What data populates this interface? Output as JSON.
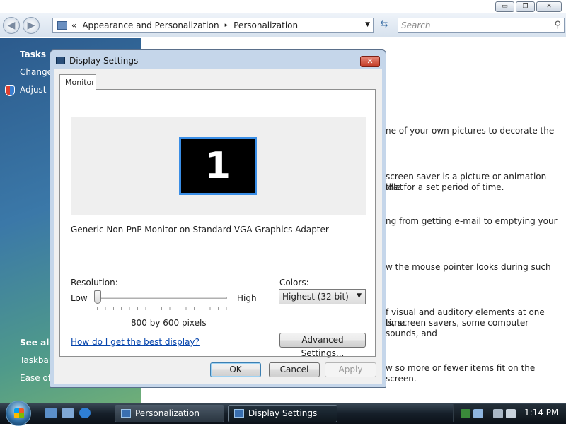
{
  "explorer": {
    "window_controls": {
      "minimize": "▭",
      "restore": "❐",
      "close": "✕"
    },
    "breadcrumb": {
      "prefix": "«",
      "item1": "Appearance and Personalization",
      "sep": "▸",
      "item2": "Personalization"
    },
    "search_placeholder": "Search",
    "left_pane": {
      "tasks_title": "Tasks",
      "link1": "Change",
      "link2": "Adjust f",
      "see_also_title": "See als",
      "link3": "Taskbar",
      "link4": "Ease of"
    },
    "content_lines": [
      "ne of your own pictures to decorate the",
      "screen saver is a picture or animation that",
      " idle for a set period of time.",
      "ng from getting e-mail to emptying your",
      "w the mouse pointer looks during such",
      "f visual and auditory elements at one time",
      "ls, screen savers, some computer sounds, and",
      "w so more or fewer items fit on the screen."
    ]
  },
  "dialog": {
    "title": "Display Settings",
    "close_glyph": "✕",
    "tab_label": "Monitor",
    "monitor_number": "1",
    "adapter": "Generic Non-PnP Monitor on Standard VGA Graphics Adapter",
    "resolution_label": "Resolution:",
    "low_label": "Low",
    "high_label": "High",
    "resolution_value": "800 by 600 pixels",
    "resolution_slider_fraction": 0.0,
    "colors_label": "Colors:",
    "colors_value": "Highest (32 bit)",
    "help_link": "How do I get the best display?",
    "advanced_button": "Advanced Settings...",
    "ok_button": "OK",
    "cancel_button": "Cancel",
    "apply_button": "Apply"
  },
  "taskbar": {
    "task1": "Personalization",
    "task2": "Display Settings",
    "clock": "1:14 PM"
  },
  "colors": {
    "monitor_border": "#3a8ee6",
    "link": "#0645ad",
    "taskbar": "#16202a"
  }
}
